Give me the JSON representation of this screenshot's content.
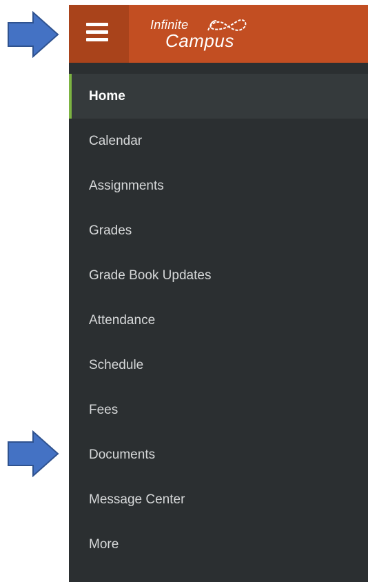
{
  "header": {
    "menu_icon": "hamburger-menu-icon",
    "brand_top": "Infinite",
    "brand_bottom": "Campus",
    "brand_color": "#c24e22",
    "menu_button_color": "#a9431b"
  },
  "sidebar": {
    "background_color": "#2b2f31",
    "active_indicator_color": "#7cb342",
    "items": [
      {
        "label": "Home",
        "active": true
      },
      {
        "label": "Calendar",
        "active": false
      },
      {
        "label": "Assignments",
        "active": false
      },
      {
        "label": "Grades",
        "active": false
      },
      {
        "label": "Grade Book Updates",
        "active": false
      },
      {
        "label": "Attendance",
        "active": false
      },
      {
        "label": "Schedule",
        "active": false
      },
      {
        "label": "Fees",
        "active": false
      },
      {
        "label": "Documents",
        "active": false
      },
      {
        "label": "Message Center",
        "active": false
      },
      {
        "label": "More",
        "active": false
      }
    ]
  },
  "annotations": {
    "arrow_color": "#4472c4",
    "arrows": [
      {
        "points_to": "hamburger-menu-button",
        "icon": "right-arrow-icon"
      },
      {
        "points_to": "sidebar-item-documents",
        "icon": "right-arrow-icon"
      }
    ]
  }
}
